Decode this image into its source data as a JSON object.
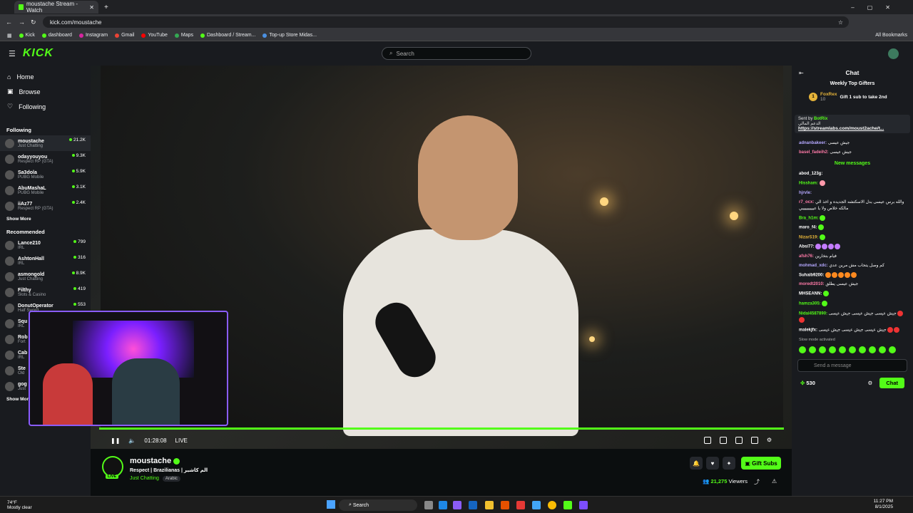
{
  "browser": {
    "tab_title": "moustache Stream - Watch",
    "url": "kick.com/moustache",
    "bookmarks": [
      "Kick",
      "dashboard",
      "Instagram",
      "Gmail",
      "YouTube",
      "Maps",
      "Dashboard / Stream...",
      "Top-up Store Midas..."
    ],
    "all_bookmarks": "All Bookmarks"
  },
  "header": {
    "logo": "KICK",
    "search_placeholder": "Search"
  },
  "sidebar": {
    "nav": [
      "Home",
      "Browse",
      "Following"
    ],
    "following_title": "Following",
    "following": [
      {
        "name": "moustache",
        "category": "Just Chatting",
        "viewers": "21.2K"
      },
      {
        "name": "odayyouyou",
        "category": "Respect RP (GTA)",
        "viewers": "9.3K"
      },
      {
        "name": "Sa3dola",
        "category": "PUBG Mobile",
        "viewers": "5.9K"
      },
      {
        "name": "AbuMashaL",
        "category": "PUBG Mobile",
        "viewers": "3.1K"
      },
      {
        "name": "iiAz77",
        "category": "Respect RP (GTA)",
        "viewers": "2.4K"
      }
    ],
    "show_more": "Show More",
    "recommended_title": "Recommended",
    "recommended": [
      {
        "name": "Lance210",
        "category": "IRL",
        "viewers": "799"
      },
      {
        "name": "AshtonHall",
        "category": "IRL",
        "viewers": "316"
      },
      {
        "name": "asmongold",
        "category": "Just Chatting",
        "viewers": "8.9K"
      },
      {
        "name": "Filthy",
        "category": "Slots & Casino",
        "viewers": "419"
      },
      {
        "name": "DonutOperator",
        "category": "Half Sword",
        "viewers": "553"
      },
      {
        "name": "Squ",
        "category": "IRL",
        "viewers": ""
      },
      {
        "name": "Rob",
        "category": "Fort",
        "viewers": ""
      },
      {
        "name": "Cab",
        "category": "IRL",
        "viewers": ""
      },
      {
        "name": "Ste",
        "category": "Old",
        "viewers": ""
      },
      {
        "name": "gog",
        "category": "Just",
        "viewers": ""
      }
    ],
    "show_more_2": "Show More"
  },
  "player": {
    "time": "01:28:08",
    "live": "LIVE"
  },
  "stream": {
    "name": "moustache",
    "title": "Respect | Brazilianas | الم كاشير",
    "category": "Just Chatting",
    "tag": "Arabic",
    "live_badge": "LIVE",
    "gift_subs": "Gift Subs",
    "viewers_count": "21,275",
    "viewers_label": "Viewers"
  },
  "chat": {
    "title": "Chat",
    "top_gifters": "Weekly Top Gifters",
    "gifter_name": "FoxRex",
    "gifter_count": "10",
    "gift_prompt": "Gift 1 sub to take 2nd",
    "pinned_sender_label": "Sent by",
    "pinned_sender": "BotRix",
    "pinned_text": "الدعم المالي",
    "pinned_link": "https://streamlabs.com/moust2ache/t...",
    "messages_top": [
      {
        "user": "adnanbakeer:",
        "text": "جيش عيسى",
        "color": "#b5a8ff"
      },
      {
        "user": "basel_fadeih2:",
        "text": "جيش عيسى",
        "color": "#ff7aa8"
      }
    ],
    "new_messages": "New messages",
    "messages": [
      {
        "user": "abod_123g:",
        "text": "",
        "color": "#ffffff"
      },
      {
        "user": "Hissham:",
        "text": "",
        "color": "#53fc18"
      },
      {
        "user": "hjrvle:",
        "text": "",
        "color": "#b5a8ff"
      },
      {
        "user": "r7_ocx:",
        "text": "والله برس عيسى بدل الاسكتشه الجديده و اخذ الي مالكه خلاص ولا يا عيييييييييي",
        "color": "#ff7aa8"
      },
      {
        "user": "Bra_h1m:",
        "text": "",
        "color": "#53fc18"
      },
      {
        "user": "maro_f4:",
        "text": "",
        "color": "#ffffff"
      },
      {
        "user": "NizarS19:",
        "text": "",
        "color": "#e6b43a"
      },
      {
        "user": "Absi77:",
        "text": "",
        "color": "#ffffff"
      },
      {
        "user": "afsh76:",
        "text": "فيام بتخارين",
        "color": "#ff7aa8"
      },
      {
        "user": "mohmad_xdc:",
        "text": "كم وصل يتحاب مش مرين عدي",
        "color": "#b5a8ff"
      },
      {
        "user": "Suhaib9200:",
        "text": "",
        "color": "#ffffff"
      },
      {
        "user": "moredt2010:",
        "text": "جيش عيسى يطلق",
        "color": "#ff7aa8"
      },
      {
        "user": "MHSEANN:",
        "text": "",
        "color": "#ffffff"
      },
      {
        "user": "hamza305:",
        "text": "",
        "color": "#53fc18"
      },
      {
        "user": "Nidal4587890:",
        "text": "جيش عيسى جيش عيسى جيش عيسى",
        "color": "#53fc18"
      },
      {
        "user": "malekjfx:",
        "text": "جيش عيسى جيش عيسى جيش عيسى",
        "color": "#ffffff"
      }
    ],
    "slow_mode": "Slow mode activated",
    "send_placeholder": "Send a message",
    "points": "530",
    "chat_button": "Chat"
  },
  "taskbar": {
    "temp": "74°F",
    "weather": "Mostly clear",
    "search": "Search",
    "time": "11:27 PM",
    "date": "8/1/2025"
  },
  "colors": {
    "accent": "#53fc18",
    "bg": "#0b0e0f",
    "panel": "#191b1f"
  }
}
